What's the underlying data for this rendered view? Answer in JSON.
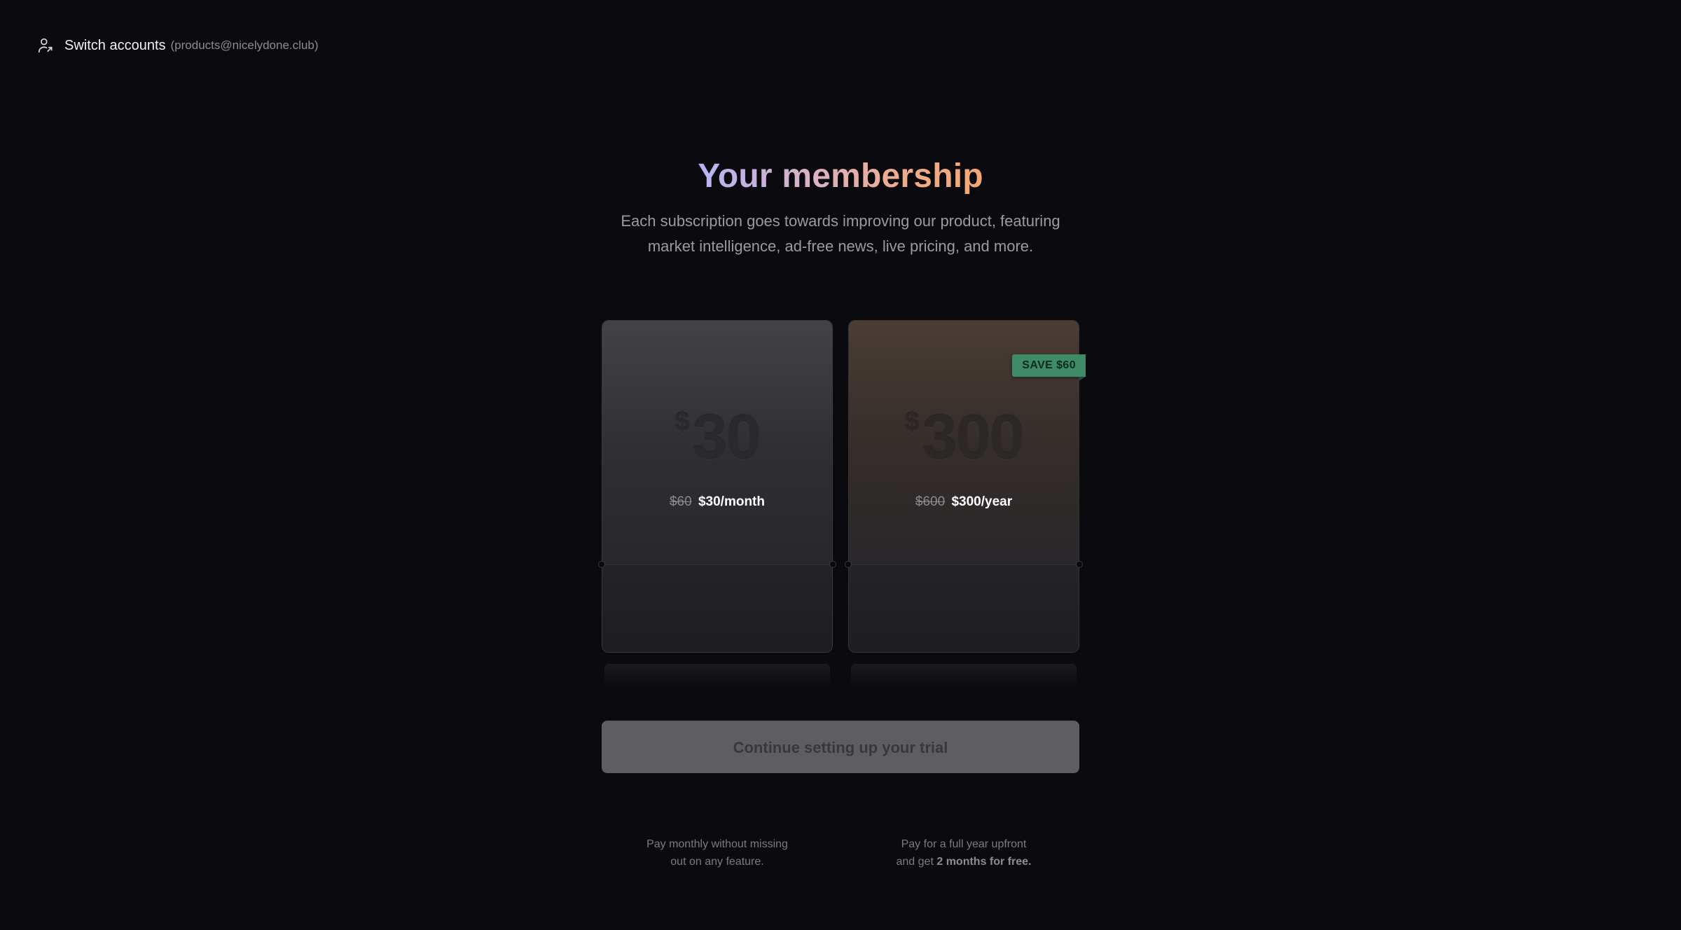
{
  "account": {
    "switch_label": "Switch accounts",
    "email": "(products@nicelydone.club)",
    "icon": "user-switch-icon"
  },
  "header": {
    "title": "Your membership",
    "subtitle_line1": "Each subscription goes towards improving our product, featuring",
    "subtitle_line2": "market intelligence, ad-free news, live pricing, and more."
  },
  "plans": [
    {
      "id": "monthly",
      "currency": "$",
      "amount": "30",
      "old_price": "$60",
      "price_label": "$30/month",
      "desc_line1": "Pay monthly without missing",
      "desc_line2": "out on any feature."
    },
    {
      "id": "yearly",
      "currency": "$",
      "amount": "300",
      "old_price": "$600",
      "price_label": "$300/year",
      "badge": "SAVE $60",
      "desc_line1": "Pay for a full year upfront",
      "desc_line2_prefix": "and get",
      "desc_line2_bold": "2 months for free."
    }
  ],
  "cta": {
    "label": "Continue setting up your trial",
    "disabled": true
  },
  "colors": {
    "background": "#0b0b0f",
    "badge": "#3f8a68",
    "title_gradient_start": "#b6b4f6",
    "title_gradient_end": "#f1a873",
    "button_disabled": "#5e5e62"
  }
}
